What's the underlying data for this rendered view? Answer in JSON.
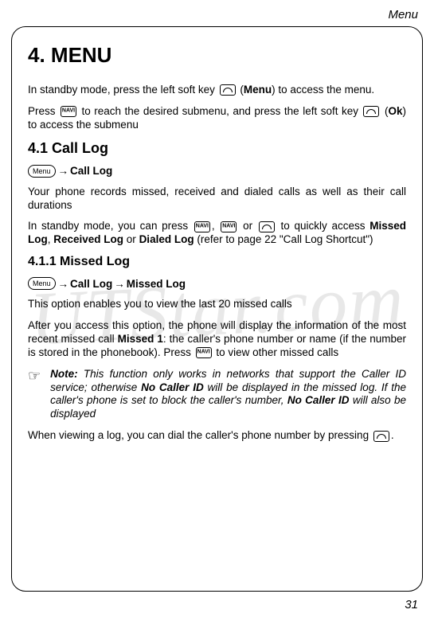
{
  "header": {
    "running_title": "Menu"
  },
  "watermark": "UTStar.com",
  "chapter": {
    "title": "4. MENU"
  },
  "intro": {
    "p1a": "In standby mode, press the left soft key ",
    "p1b": " (",
    "p1c": "Menu",
    "p1d": ") to access the menu.",
    "p2a": "Press ",
    "p2b": " to reach the desired submenu, and press the left soft key ",
    "p2c": " (",
    "p2d": "Ok",
    "p2e": ") to access the submenu"
  },
  "s41": {
    "title": "4.1 Call Log",
    "menu_label": "Menu",
    "bc_arrow": "→",
    "bc_label": "Call Log",
    "p1": "Your phone records missed, received and dialed calls as well as their call durations",
    "p2a": "In standby mode, you can press ",
    "p2b": ", ",
    "p2c": " or ",
    "p2d": " to quickly access ",
    "p2e": "Missed Log",
    "p2f": ", ",
    "p2g": "Received Log",
    "p2h": " or ",
    "p2i": "Dialed Log",
    "p2j": " (refer to page 22 \"Call Log Shortcut\")"
  },
  "s411": {
    "title": "4.1.1 Missed Log",
    "menu_label": "Menu",
    "bc_arrow1": "→",
    "bc_label1": "Call Log",
    "bc_arrow2": "→",
    "bc_label2": "Missed Log",
    "p1": "This option enables you to view the last 20 missed calls",
    "p2a": "After you access this option, the phone will display the information of the most recent missed call ",
    "p2b": "Missed 1",
    "p2c": ": the caller's phone number or name (if the number is stored in the phonebook). Press ",
    "p2d": " to view other missed calls",
    "note_label": "Note:",
    "note_a": " This function only works in networks that support the Caller ID service; otherwise ",
    "note_b": "No Caller ID",
    "note_c": " will be displayed in the missed log. If the caller's phone is set to block the caller's number, ",
    "note_d": "No Caller ID",
    "note_e": " will also be displayed",
    "p3a": "When viewing a log, you can dial the caller's phone number by pressing ",
    "p3b": "."
  },
  "footer": {
    "page_number": "31"
  }
}
